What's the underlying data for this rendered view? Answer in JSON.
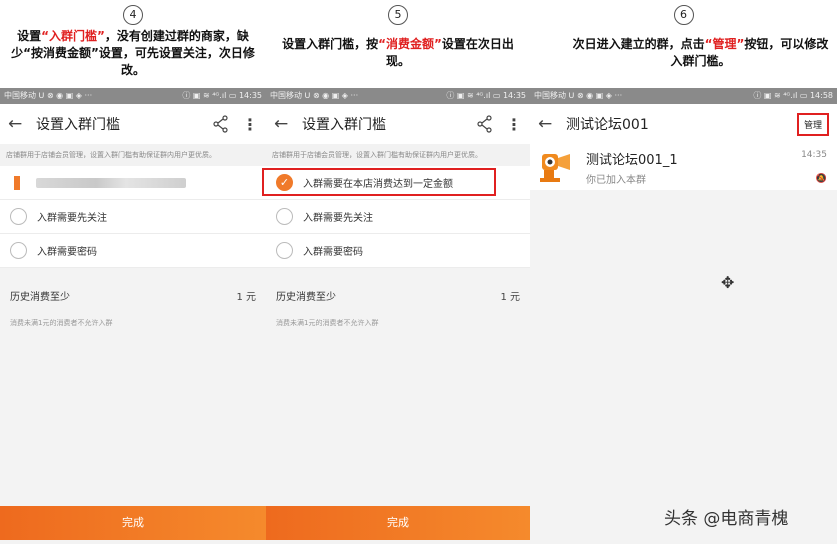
{
  "step4": {
    "number": "4",
    "caption": {
      "p1": "设置",
      "q1": "“入群门槛”",
      "p2": "，没有创建过群的商家，缺少“按消费金额”设置，可先设置关注，次日修改。"
    }
  },
  "step5": {
    "number": "5",
    "caption": {
      "p1": "设置入群门槛，按",
      "q1": "“消费金额”",
      "p2": "设置在次日出现。"
    }
  },
  "step6": {
    "number": "6",
    "caption": {
      "p1": "次日进入建立的群，点击",
      "q1": "“管理”",
      "p2": "按钮，可以修改入群门槛。"
    }
  },
  "statusbar": {
    "left": "中国移动 ᑌ ⊗ ◉ ▣ ◈ ···",
    "right_1": "ⓘ ▣ ≋ ⁴ᴳ.ıl ▭ 14:35",
    "right_3": "ⓘ ▣ ≋ ⁴ᴳ.ıl ▭ 14:58"
  },
  "screen1": {
    "title": "设置入群门槛",
    "notice": "店铺群用于店铺会员管理，设置入群门槛有助保证群内用户更优质。",
    "option_follow": "入群需要先关注",
    "option_password": "入群需要密码",
    "history_label": "历史消费至少",
    "history_value": "1 元",
    "hint": "消费未满1元的消费者不允许入群",
    "done": "完成"
  },
  "screen2": {
    "title": "设置入群门槛",
    "notice": "店铺群用于店铺会员管理，设置入群门槛有助保证群内用户更优质。",
    "option_amount": "入群需要在本店消费达到一定金额",
    "option_follow": "入群需要先关注",
    "option_password": "入群需要密码",
    "history_label": "历史消费至少",
    "history_value": "1 元",
    "hint": "消费未满1元的消费者不允许入群",
    "done": "完成"
  },
  "screen3": {
    "title": "测试论坛001",
    "manage": "管理",
    "group_name": "测试论坛001_1",
    "group_sub": "你已加入本群",
    "group_time": "14:35"
  },
  "watermark": "头条 @电商青槐",
  "colors": {
    "accent_red": "#e02020",
    "accent_orange": "#f07a2a"
  },
  "icons": {
    "back": "back-arrow-icon",
    "share": "share-icon",
    "more": "more-vertical-icon",
    "check": "check-icon",
    "mute": "bell-mute-icon",
    "move": "move-cursor-icon"
  }
}
